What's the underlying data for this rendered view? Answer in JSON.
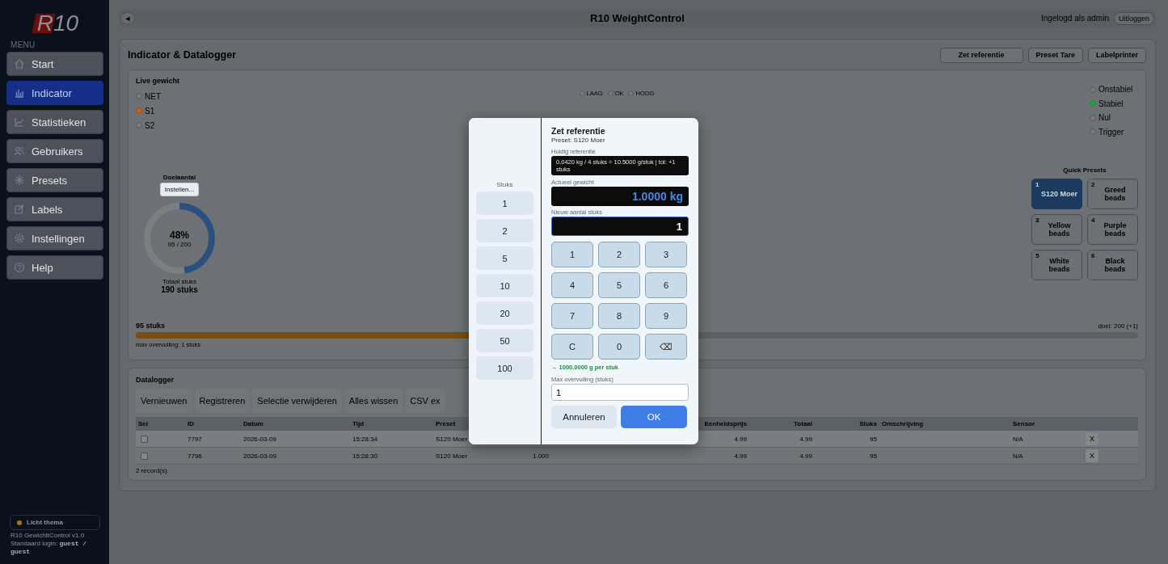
{
  "sidebar": {
    "logo": "R10",
    "menu_label": "MENU",
    "nav": [
      {
        "label": "Start",
        "selected": false
      },
      {
        "label": "Indicator",
        "selected": true
      },
      {
        "label": "Statistieken",
        "selected": false
      },
      {
        "label": "Gebruikers",
        "selected": false
      },
      {
        "label": "Presets",
        "selected": false
      },
      {
        "label": "Labels",
        "selected": false
      },
      {
        "label": "Instellingen",
        "selected": false
      },
      {
        "label": "Help",
        "selected": false
      }
    ],
    "theme_toggle": "Licht thema",
    "version": "R10 GewichttControl v1.0",
    "login_note": "Standaard login: **guest / guest**"
  },
  "topbar": {
    "back": "◄",
    "title": "R10 WeightControl",
    "user": "Ingelogd als admin",
    "logout": "Uitloggen"
  },
  "page": {
    "title": "Indicator & Datalogger",
    "actions": [
      "Zet referentie",
      "Preset Tare",
      "Labelprinter"
    ]
  },
  "live": {
    "title": "Live gewicht",
    "sources": [
      {
        "label": "NET",
        "selected": false
      },
      {
        "label": "S1",
        "selected": true
      },
      {
        "label": "S2",
        "selected": false
      }
    ],
    "limits": [
      {
        "label": "LAAG",
        "on": false
      },
      {
        "label": "OK",
        "on": false
      },
      {
        "label": "HOOG",
        "on": false
      }
    ],
    "status": [
      {
        "label": "Onstabiel",
        "on": false
      },
      {
        "label": "Stabiel",
        "on": true
      },
      {
        "label": "Nul",
        "on": false
      },
      {
        "label": "Trigger",
        "on": false
      }
    ],
    "target": {
      "label": "Doelaantal",
      "button": "Instellen...",
      "percent": "48%",
      "fraction": "95 / 200",
      "level": 0.475,
      "total_label": "Totaal stuks",
      "total": "190 stuks"
    },
    "quick_presets": {
      "title": "Quick Presets",
      "items": [
        {
          "number": "1",
          "label": "S120 Moer",
          "selected": true
        },
        {
          "number": "2",
          "label": "Greed beads",
          "selected": false
        },
        {
          "number": "3",
          "label": "Yellow beads",
          "selected": false
        },
        {
          "number": "4",
          "label": "Purple beads",
          "selected": false
        },
        {
          "number": "5",
          "label": "White beads",
          "selected": false
        },
        {
          "number": "6",
          "label": "Black beads",
          "selected": false
        }
      ]
    },
    "progress": {
      "count": "95 stuks",
      "goal": "doel: 200 (+1)",
      "level": 0.475,
      "note": "max overvulling: 1 stuks"
    }
  },
  "datalogger": {
    "title": "Datalogger",
    "buttons": [
      "Vernieuwen",
      "Registreren",
      "Selectie verwijderen",
      "Alles wissen",
      "CSV ex"
    ],
    "table": {
      "columns": [
        "Sel",
        "ID",
        "Datum",
        "Tijd",
        "Preset",
        "",
        "Eenheidsprijs",
        "Totaal",
        "Stuks",
        "Omschrijving",
        "Sensor",
        ""
      ],
      "rows": [
        {
          "selected": false,
          "cells": [
            "",
            "7797",
            "2026-03-09",
            "15:28:34",
            "S120 Moer",
            "",
            "4.99",
            "4.99",
            "95",
            "",
            "N/A",
            "X"
          ]
        },
        {
          "selected": false,
          "cells": [
            "",
            "7796",
            "2026-03-09",
            "15:28:30",
            "S120 Moer",
            "1.000",
            "4.99",
            "4.99",
            "95",
            "",
            "N/A",
            "X"
          ]
        }
      ]
    },
    "footer": "2 record(s)."
  },
  "dialog": {
    "counts_label": "Stuks",
    "counts": [
      "1",
      "2",
      "5",
      "10",
      "20",
      "50",
      "100"
    ],
    "title": "Zet referentie",
    "preset": "Preset: S120 Moer",
    "current_label": "Huidig referentie",
    "current": "0.0420 kg / 4 stuks = 10.5000 g/stuk | tol: +1 stuks",
    "weight_label": "Actueel gewicht",
    "weight": "1.0000 kg",
    "count_label": "Nieuw aantal stuks",
    "count": "1",
    "keys": [
      "1",
      "2",
      "3",
      "4",
      "5",
      "6",
      "7",
      "8",
      "9",
      "C",
      "0",
      "⌫"
    ],
    "result": "→ 1000.0000 g per stuk",
    "overfill_label": "Max overvulling (stuks)",
    "overfill": "1",
    "cancel": "Annuleren",
    "ok": "OK"
  }
}
